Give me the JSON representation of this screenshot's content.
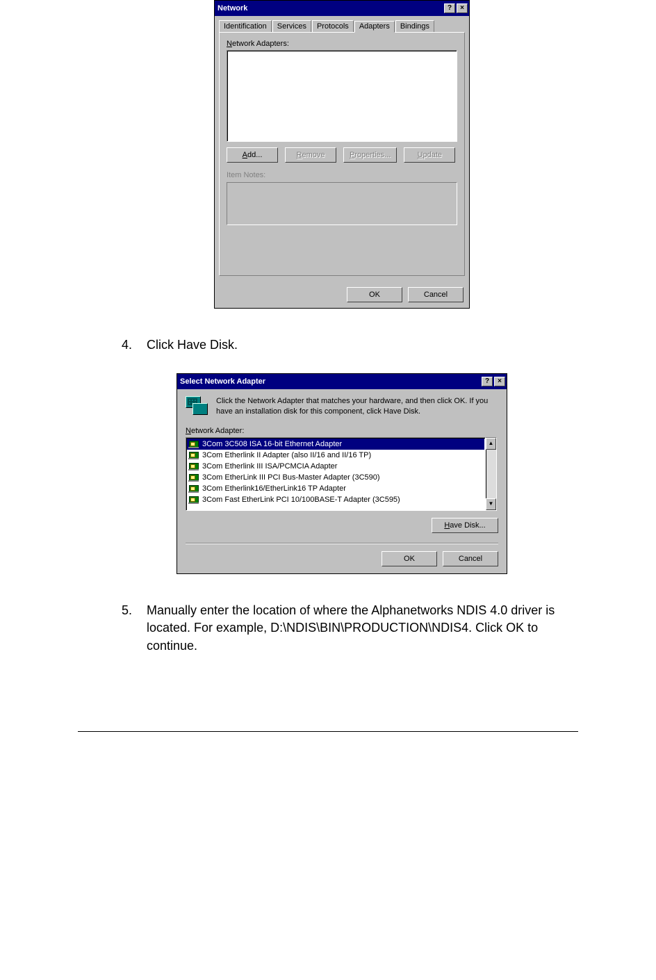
{
  "dialog1": {
    "title": "Network",
    "help_btn": "?",
    "close_btn": "×",
    "tabs": [
      {
        "label": "Identification"
      },
      {
        "label": "Services"
      },
      {
        "label": "Protocols"
      },
      {
        "label": "Adapters"
      },
      {
        "label": "Bindings"
      }
    ],
    "adapters_label_pre": "N",
    "adapters_label": "etwork Adapters:",
    "buttons": {
      "add_pre": "A",
      "add": "dd...",
      "remove_pre": "R",
      "remove": "emove",
      "props_pre": "P",
      "props": "roperties...",
      "update_pre": "U",
      "update": "pdate"
    },
    "item_notes_label": "Item Notes:",
    "ok": "OK",
    "cancel": "Cancel"
  },
  "step4": {
    "num": "4.",
    "text": "Click Have Disk."
  },
  "dialog2": {
    "title": "Select Network Adapter",
    "help_btn": "?",
    "close_btn": "×",
    "message": "Click the Network Adapter that matches your hardware, and then click OK.  If you have an installation disk for this component, click Have Disk.",
    "list_label_pre": "N",
    "list_label": "etwork Adapter:",
    "items": [
      "3Com 3C508 ISA 16-bit Ethernet Adapter",
      "3Com Etherlink II Adapter (also II/16 and II/16 TP)",
      "3Com Etherlink III ISA/PCMCIA Adapter",
      "3Com EtherLink III PCI Bus-Master Adapter (3C590)",
      "3Com Etherlink16/EtherLink16 TP Adapter",
      "3Com Fast EtherLink PCI 10/100BASE-T Adapter (3C595)"
    ],
    "scroll_up": "▲",
    "scroll_down": "▼",
    "have_disk_pre": "H",
    "have_disk": "ave Disk...",
    "ok": "OK",
    "cancel": "Cancel"
  },
  "step5": {
    "num": "5.",
    "text": "Manually enter the location of where the Alphanetworks NDIS 4.0 driver is located. For example, D:\\NDIS\\BIN\\PRODUCTION\\NDIS4. Click OK to continue."
  }
}
